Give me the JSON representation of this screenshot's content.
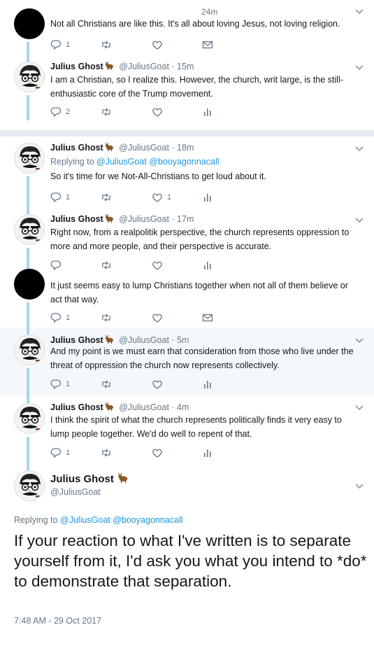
{
  "tweets": [
    {
      "text": "Not all Christians are like this. It's all about loving Jesus, not loving religion.",
      "time": "24m",
      "reply_count": "1",
      "retweet_count": "",
      "like_count": ""
    },
    {
      "name": "Julius Ghost",
      "handle": "@JuliusGoat",
      "time": "· 15m",
      "text": "I am a Christian, so I realize this. However, the church, writ large, is the still-enthusiastic core of the Trump movement.",
      "reply_count": "2"
    },
    {
      "name": "Julius Ghost",
      "handle": "@JuliusGoat",
      "time": "· 18m",
      "replying_label": "Replying to",
      "replying_to": "@JuliusGoat @booyagonnacall",
      "text": "So it's time for we Not-All-Christians to get loud about it.",
      "reply_count": "1",
      "like_count": "1"
    },
    {
      "name": "Julius Ghost",
      "handle": "@JuliusGoat",
      "time": "· 17m",
      "text": "Right now, from a realpolitik perspective, the church represents oppression to more and more people, and their perspective is accurate."
    },
    {
      "text": "It just seems easy to lump Christians together when not all of them believe or act that way.",
      "reply_count": "1"
    },
    {
      "name": "Julius Ghost",
      "handle": "@JuliusGoat",
      "time": "· 5m",
      "text": "And my point is we must earn that consideration from those who live under the threat of oppression the church now represents collectively.",
      "reply_count": "1"
    },
    {
      "name": "Julius Ghost",
      "handle": "@JuliusGoat",
      "time": "· 4m",
      "text": "I think the spirit of what the church represents politically finds it very easy to lump people together. We'd do well to repent of that.",
      "reply_count": "1"
    }
  ],
  "main": {
    "name": "Julius Ghost",
    "handle": "@JuliusGoat",
    "replying_label": "Replying to",
    "replying_to": "@JuliusGoat @booyagonnacall",
    "text": "If your reaction to what I've written is to separate yourself from it, I'd ask you what you intend to *do* to demonstrate that separation.",
    "timestamp": "7:48 AM - 29 Oct 2017"
  },
  "icons": {
    "reply": "reply-icon",
    "retweet": "retweet-icon",
    "like": "heart-icon",
    "dm": "envelope-icon",
    "analytics": "analytics-icon",
    "more": "chevron-down-icon",
    "badge": "goat-emoji-icon"
  },
  "colors": {
    "link": "#1b95e0",
    "muted": "#657786",
    "thread_line": "#a9d5ea",
    "highlight_bg": "#f5f8fa"
  }
}
